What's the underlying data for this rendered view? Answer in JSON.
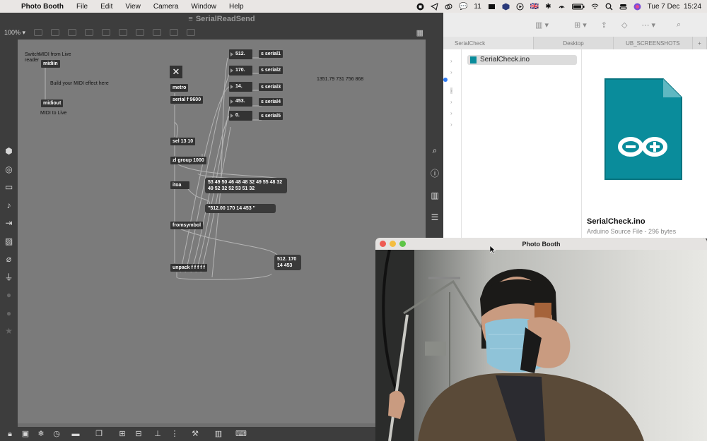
{
  "menubar": {
    "app_name": "Photo Booth",
    "menus": [
      "File",
      "Edit",
      "View",
      "Camera",
      "Window",
      "Help"
    ],
    "wechat_badge": "11",
    "language": "🇬🇧",
    "datetime": "Tue 7 Dec  15:24"
  },
  "max": {
    "window_title": "SerialReadSend",
    "zoom": "100%",
    "objects": {
      "midiin": "midiin",
      "midiout": "midiout",
      "metro": "metro",
      "serial": "serial f 9600",
      "sel": "sel 13 10",
      "zl": "zl group 1000",
      "itoa": "itoa",
      "fromsymbol": "fromsymbol",
      "unpack": "unpack f f f f f",
      "send1": "s serial1",
      "send2": "s serial2",
      "send3": "s serial3",
      "send4": "s serial4",
      "send5": "s serial5"
    },
    "numbers": [
      "512.",
      "170.",
      "14.",
      "453.",
      "0."
    ],
    "messages": {
      "ascii": "53 49 50 46 48 48 32 49 55 48 32\n49 52 32 52 53 51 32",
      "string": "\"512.00 170 14 453 \"",
      "list": "512. 170\n14 453"
    },
    "comments": {
      "switch": "Switch\nreader",
      "midi_from": "MIDI from Live",
      "build": "Build your MIDI effect here",
      "midi_to": "MIDI to Live",
      "readout": "1351.79 731 756 868"
    }
  },
  "finder": {
    "tabs": [
      "SerialCheck",
      "Desktop",
      "UB_SCREENSHOTS"
    ],
    "file_list_item": "SerialCheck.ino",
    "preview_name": "SerialCheck.ino",
    "preview_kind": "Arduino Source File - 296 bytes",
    "accent": "#0a8c9b"
  },
  "photobooth": {
    "window_title": "Photo Booth"
  }
}
